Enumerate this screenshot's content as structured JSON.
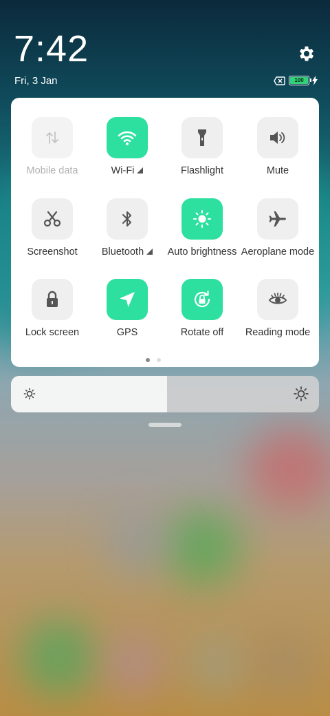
{
  "status": {
    "time": "7:42",
    "date": "Fri, 3 Jan",
    "battery_level": "100",
    "battery_color": "#33d17a",
    "icons": [
      "settings-icon",
      "no-sim-icon",
      "battery-icon",
      "charging-icon"
    ]
  },
  "colors": {
    "tile_active": "#2ee0a0",
    "tile_inactive": "#efefef",
    "label": "#333333",
    "label_disabled": "#b0b0b0"
  },
  "tiles": [
    {
      "label": "Mobile data",
      "icon": "mobile-data-icon",
      "state": "disabled",
      "has_more": false
    },
    {
      "label": "Wi-Fi",
      "icon": "wifi-icon",
      "state": "on",
      "has_more": true
    },
    {
      "label": "Flashlight",
      "icon": "flashlight-icon",
      "state": "off",
      "has_more": false
    },
    {
      "label": "Mute",
      "icon": "volume-icon",
      "state": "off",
      "has_more": false
    },
    {
      "label": "Screenshot",
      "icon": "scissors-icon",
      "state": "off",
      "has_more": false
    },
    {
      "label": "Bluetooth",
      "icon": "bluetooth-icon",
      "state": "off",
      "has_more": true
    },
    {
      "label": "Auto brightness",
      "icon": "auto-brightness-icon",
      "state": "on",
      "has_more": false
    },
    {
      "label": "Aeroplane mode",
      "icon": "airplane-icon",
      "state": "off",
      "has_more": false
    },
    {
      "label": "Lock screen",
      "icon": "lock-icon",
      "state": "off",
      "has_more": false
    },
    {
      "label": "GPS",
      "icon": "location-arrow-icon",
      "state": "on",
      "has_more": false
    },
    {
      "label": "Rotate off",
      "icon": "rotation-lock-icon",
      "state": "on",
      "has_more": false
    },
    {
      "label": "Reading mode",
      "icon": "eye-icon",
      "state": "off",
      "has_more": false
    }
  ],
  "pagination": {
    "pages": 2,
    "current": 1
  },
  "brightness": {
    "level": 0.5,
    "min_icon": "brightness-low-icon",
    "max_icon": "brightness-high-icon"
  }
}
